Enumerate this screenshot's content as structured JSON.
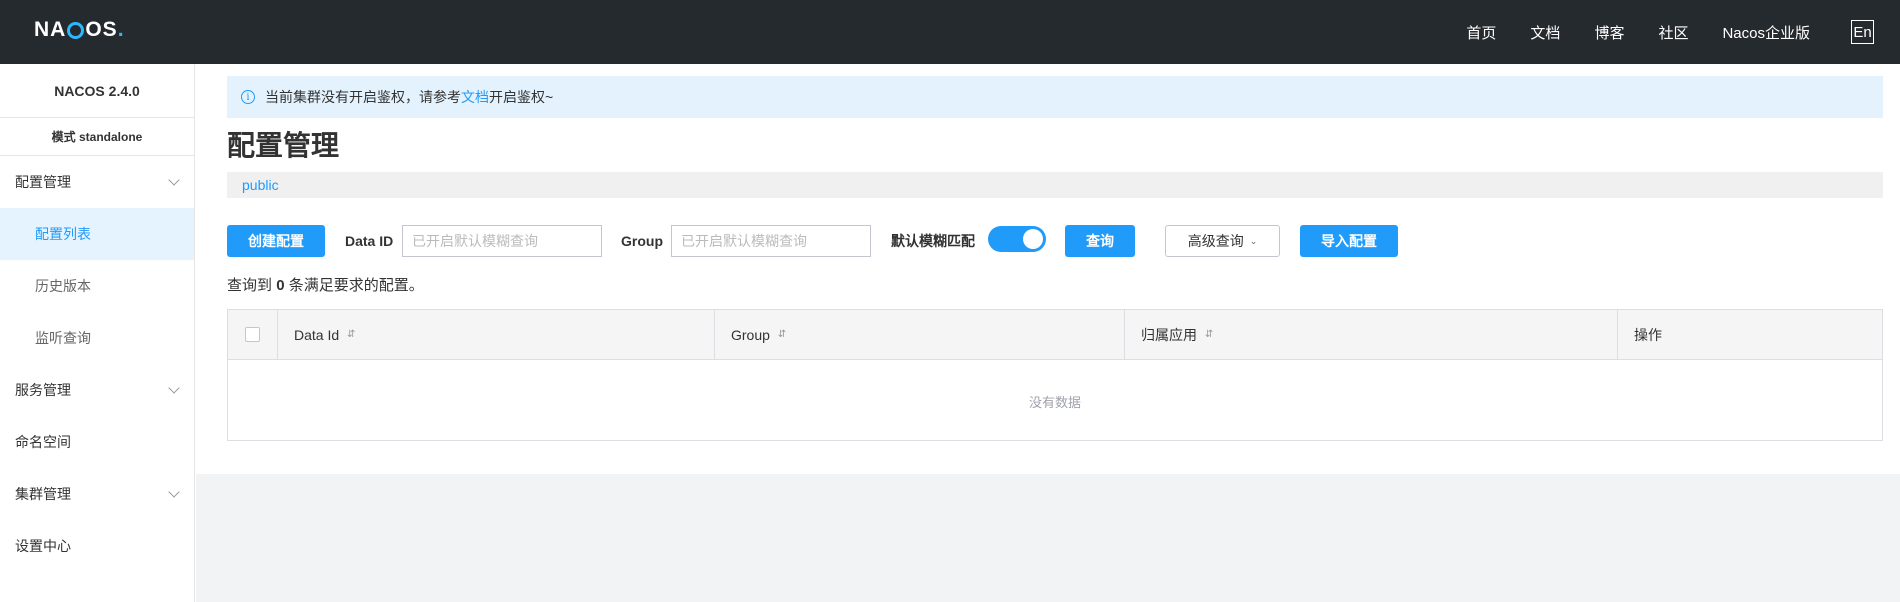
{
  "header": {
    "logo_text": "NACOS.",
    "nav": [
      "首页",
      "文档",
      "博客",
      "社区",
      "Nacos企业版"
    ],
    "lang_button": "En"
  },
  "sidebar": {
    "version": "NACOS 2.4.0",
    "mode": "模式 standalone",
    "items": [
      {
        "label": "配置管理",
        "expandable": true
      },
      {
        "label": "配置列表",
        "active": true
      },
      {
        "label": "历史版本"
      },
      {
        "label": "监听查询"
      },
      {
        "label": "服务管理",
        "expandable": true
      },
      {
        "label": "命名空间"
      },
      {
        "label": "集群管理",
        "expandable": true
      },
      {
        "label": "设置中心"
      }
    ]
  },
  "notice": {
    "text_before": "当前集群没有开启鉴权，请参考",
    "link": "文档",
    "text_after": "开启鉴权~"
  },
  "page_title": "配置管理",
  "namespace": "public",
  "toolbar": {
    "create_button": "创建配置",
    "data_id_label": "Data ID",
    "data_id_placeholder": "已开启默认模糊查询",
    "group_label": "Group",
    "group_placeholder": "已开启默认模糊查询",
    "fuzzy_label": "默认模糊匹配",
    "fuzzy_enabled": true,
    "query_button": "查询",
    "advanced_button": "高级查询",
    "import_button": "导入配置"
  },
  "result": {
    "prefix": "查询到",
    "count": "0",
    "suffix": "条满足要求的配置。"
  },
  "table": {
    "columns": [
      "Data Id",
      "Group",
      "归属应用",
      "操作"
    ],
    "sort_icon": "⇵",
    "empty_text": "没有数据"
  },
  "colors": {
    "accent": "#209bfa",
    "header_bg": "#252a2f"
  }
}
